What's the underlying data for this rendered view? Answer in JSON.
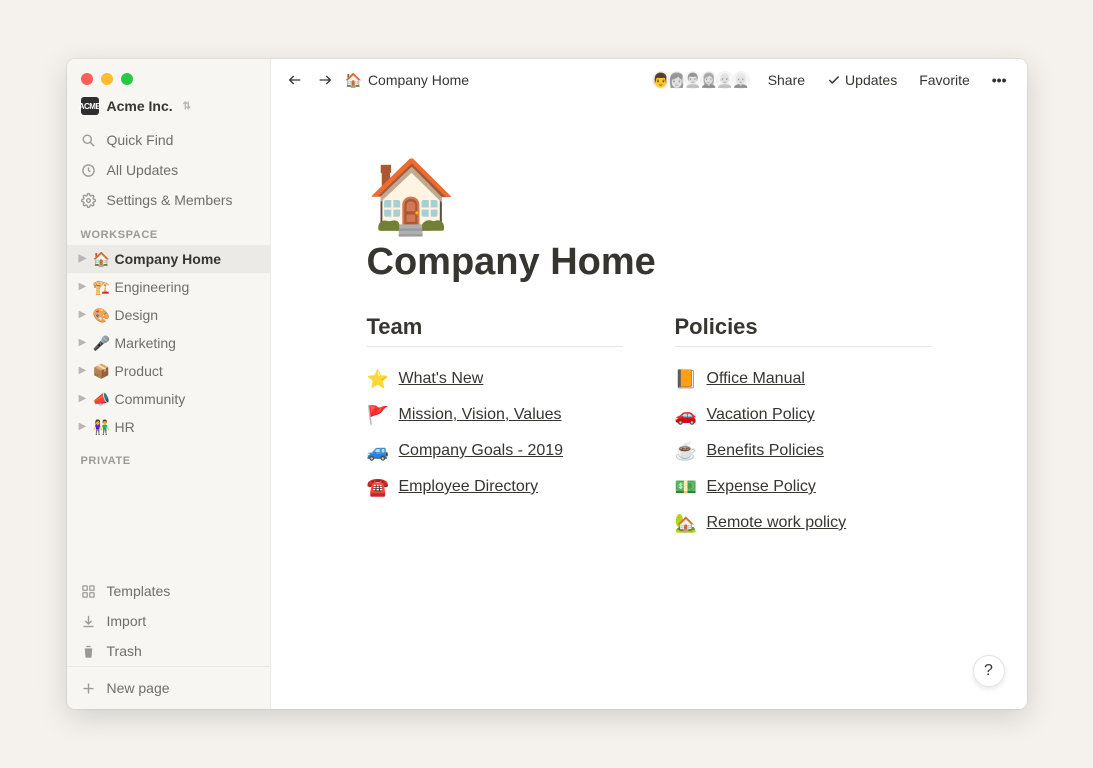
{
  "workspace": {
    "name": "Acme Inc.",
    "logo_text": "ACME"
  },
  "sidebar_nav": {
    "quick_find": "Quick Find",
    "all_updates": "All Updates",
    "settings": "Settings & Members"
  },
  "sidebar": {
    "workspace_label": "WORKSPACE",
    "private_label": "PRIVATE",
    "pages": [
      {
        "emoji": "🏠",
        "label": "Company Home",
        "active": true
      },
      {
        "emoji": "🏗️",
        "label": "Engineering",
        "active": false
      },
      {
        "emoji": "🎨",
        "label": "Design",
        "active": false
      },
      {
        "emoji": "🎤",
        "label": "Marketing",
        "active": false
      },
      {
        "emoji": "📦",
        "label": "Product",
        "active": false
      },
      {
        "emoji": "📣",
        "label": "Community",
        "active": false
      },
      {
        "emoji": "👫",
        "label": "HR",
        "active": false
      }
    ],
    "templates": "Templates",
    "import": "Import",
    "trash": "Trash",
    "new_page": "New page"
  },
  "topbar": {
    "breadcrumb_emoji": "🏠",
    "breadcrumb_label": "Company Home",
    "share": "Share",
    "updates": "Updates",
    "favorite": "Favorite",
    "more": "•••",
    "avatars": [
      "👨",
      "👩",
      "👨‍🦱",
      "👩‍🦰",
      "👨‍🦲",
      "👩‍🦳"
    ]
  },
  "page": {
    "emoji": "🏠",
    "title": "Company Home",
    "columns": [
      {
        "heading": "Team",
        "items": [
          {
            "emoji": "⭐",
            "label": "What's New"
          },
          {
            "emoji": "🚩",
            "label": "Mission, Vision, Values"
          },
          {
            "emoji": "🚙",
            "label": "Company Goals - 2019"
          },
          {
            "emoji": "☎️",
            "label": "Employee Directory"
          }
        ]
      },
      {
        "heading": "Policies",
        "items": [
          {
            "emoji": "📙",
            "label": "Office Manual"
          },
          {
            "emoji": "🚗",
            "label": "Vacation Policy"
          },
          {
            "emoji": "☕",
            "label": "Benefits Policies"
          },
          {
            "emoji": "💵",
            "label": "Expense Policy"
          },
          {
            "emoji": "🏡",
            "label": "Remote work policy"
          }
        ]
      }
    ]
  },
  "help": "?"
}
